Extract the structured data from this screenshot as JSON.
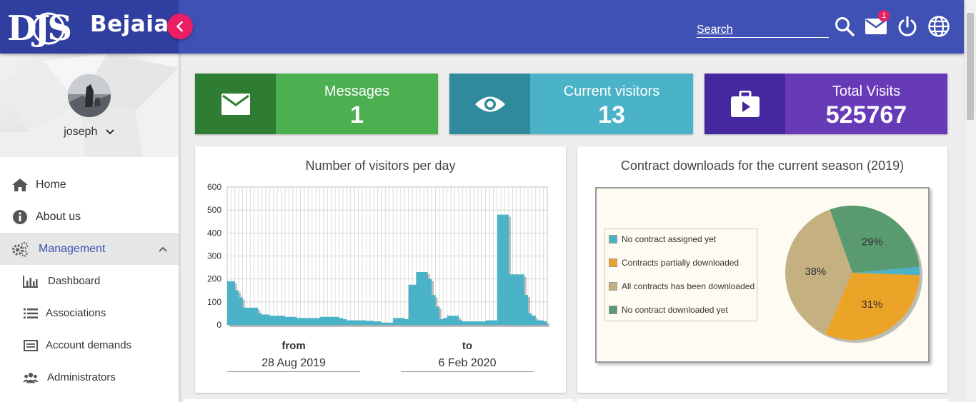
{
  "brand": {
    "logo_text": "DJS",
    "city": "Bejaia"
  },
  "search": {
    "placeholder": "Search"
  },
  "mail": {
    "badge": "1"
  },
  "user": {
    "name": "joseph"
  },
  "nav": {
    "home": "Home",
    "about": "About us",
    "management": "Management",
    "sub": {
      "dashboard": "Dashboard",
      "associations": "Associations",
      "account_demands": "Account demands",
      "administrators": "Administrators"
    }
  },
  "stats": {
    "messages": {
      "title": "Messages",
      "value": "1",
      "color": "#4caf50",
      "dark": "#2e7d32"
    },
    "visitors": {
      "title": "Current visitors",
      "value": "13",
      "color": "#4ab3c8",
      "dark": "#2f8a9c"
    },
    "visits": {
      "title": "Total Visits",
      "value": "525767",
      "color": "#673ab7",
      "dark": "#4527a0"
    }
  },
  "visitors_chart": {
    "from_label": "from",
    "from_value": "28 Aug 2019",
    "to_label": "to",
    "to_value": "6 Feb 2020"
  },
  "pie_chart": {},
  "chart_data": [
    {
      "type": "area",
      "title": "Number of visitors per day",
      "ylim": [
        0,
        600
      ],
      "yticks": [
        "0",
        "100",
        "200",
        "300",
        "400",
        "500",
        "600"
      ],
      "grid": true,
      "color": "#4ab3c8",
      "values": [
        190,
        190,
        150,
        120,
        75,
        75,
        75,
        75,
        50,
        45,
        45,
        40,
        40,
        40,
        40,
        35,
        35,
        35,
        30,
        30,
        30,
        30,
        30,
        30,
        35,
        35,
        35,
        35,
        35,
        30,
        25,
        20,
        20,
        20,
        20,
        20,
        18,
        18,
        15,
        15,
        10,
        10,
        10,
        30,
        30,
        30,
        25,
        175,
        175,
        230,
        230,
        230,
        200,
        130,
        80,
        25,
        30,
        40,
        40,
        40,
        20,
        15,
        15,
        15,
        15,
        15,
        15,
        20,
        20,
        20,
        480,
        480,
        480,
        220,
        220,
        220,
        220,
        130,
        50,
        40,
        20,
        20,
        15
      ]
    },
    {
      "type": "pie",
      "title": "Contract downloads for the current season (2019)",
      "legend_position": "left",
      "series": [
        {
          "name": "No contract assigned yet",
          "value": 2,
          "label": "",
          "color": "#4ab3c8"
        },
        {
          "name": "Contracts partially downloaded",
          "value": 31,
          "label": "31%",
          "color": "#eca428"
        },
        {
          "name": "All contracts has been downloaded",
          "value": 38,
          "label": "38%",
          "color": "#c4b080"
        },
        {
          "name": "No contract downloaded yet",
          "value": 29,
          "label": "29%",
          "color": "#5a9a70"
        }
      ]
    }
  ]
}
